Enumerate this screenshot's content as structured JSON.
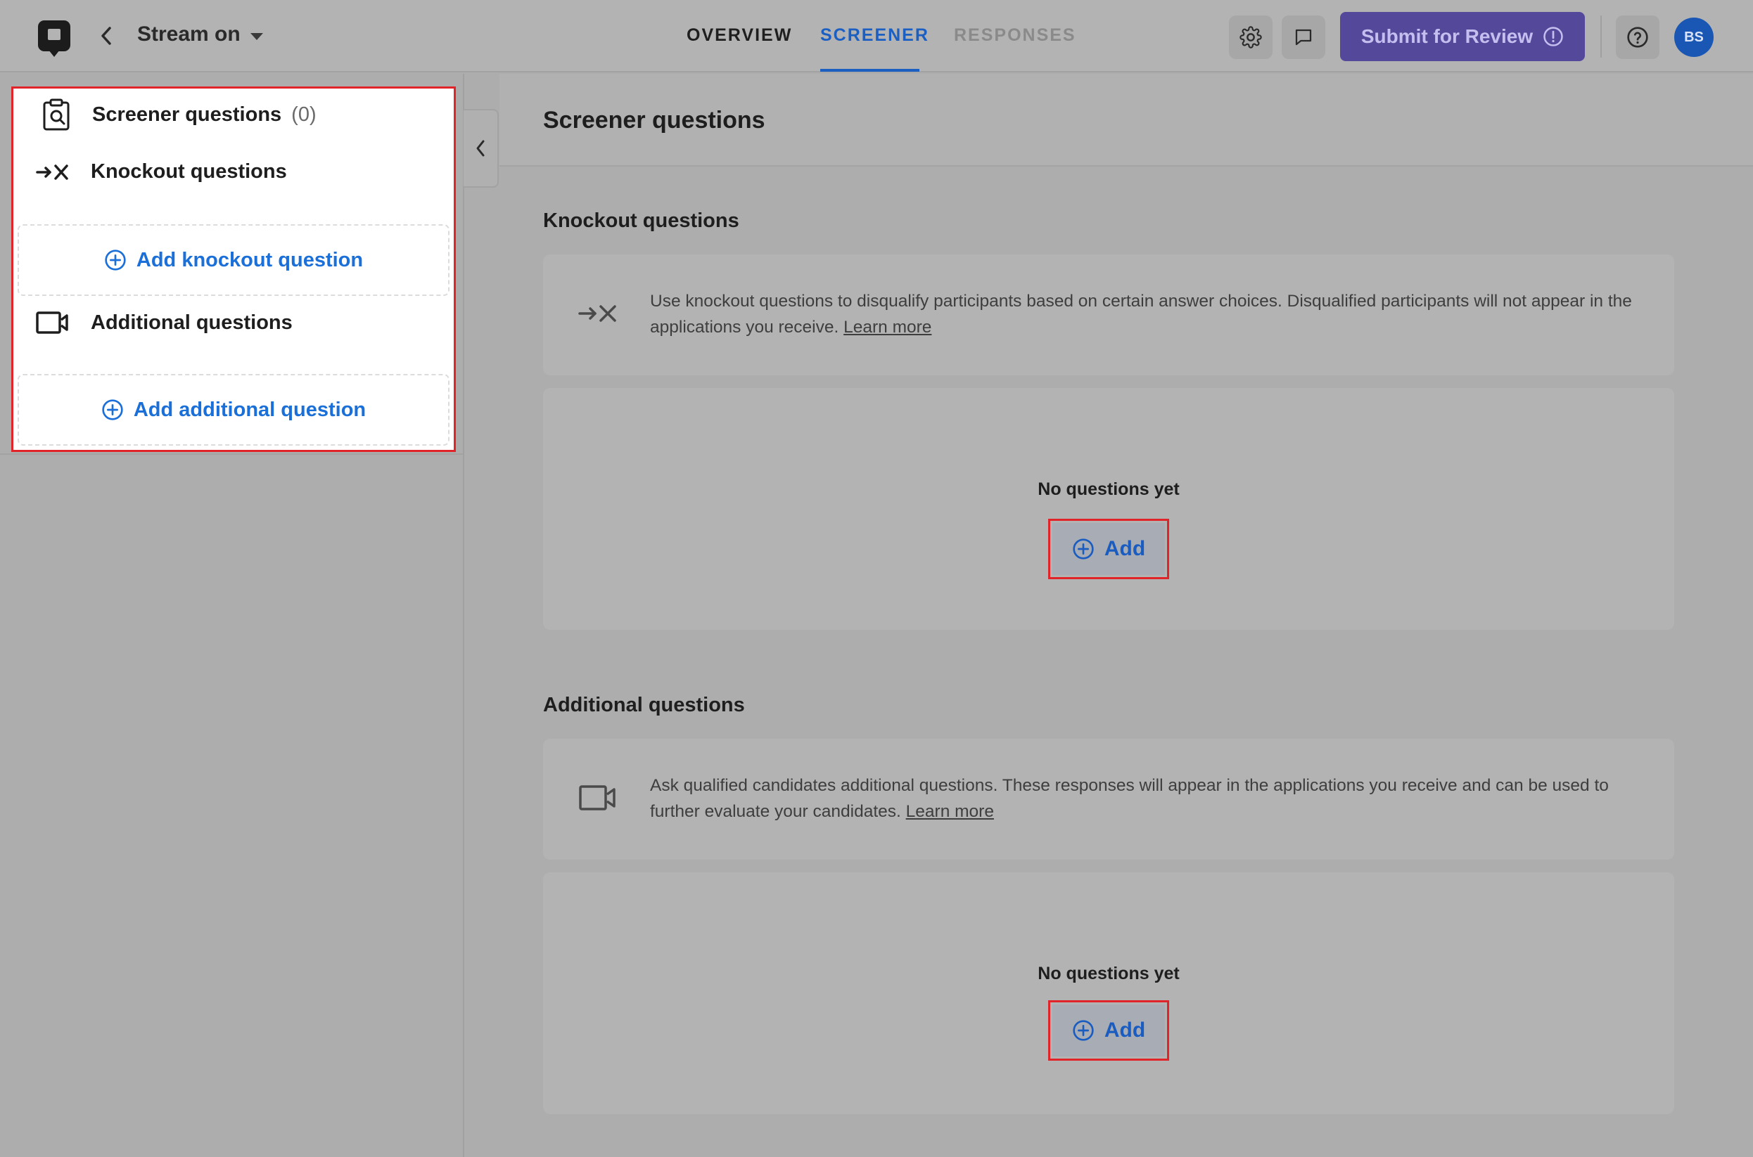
{
  "header": {
    "project_title": "Stream on",
    "tabs": [
      "OVERVIEW",
      "SCREENER",
      "RESPONSES"
    ],
    "submit_label": "Submit for Review",
    "avatar_initials": "BS"
  },
  "sidebar": {
    "screener_heading": "Screener questions",
    "screener_count": "(0)",
    "knockout_heading": "Knockout questions",
    "add_knockout_label": "Add knockout question",
    "additional_heading": "Additional questions",
    "add_additional_label": "Add additional question"
  },
  "main": {
    "title": "Screener questions",
    "knockout": {
      "title": "Knockout questions",
      "description": "Use knockout questions to disqualify participants based on certain answer choices. Disqualified participants will not appear in the applications you receive.",
      "learn_more": "Learn more",
      "empty_label": "No questions yet",
      "add_label": "Add"
    },
    "additional": {
      "title": "Additional questions",
      "description": "Ask qualified candidates additional questions. These responses will appear in the applications you receive and can be used to further evaluate your candidates.",
      "learn_more": "Learn more",
      "empty_label": "No questions yet",
      "add_label": "Add"
    }
  },
  "icons": {
    "logo": "app-logo-icon",
    "back": "chevron-left-icon",
    "dropdown": "caret-down-icon",
    "settings": "gear-icon",
    "comment": "comment-icon",
    "submit_info": "exclamation-circle-icon",
    "help": "question-circle-icon",
    "screener": "clipboard-search-icon",
    "knockout": "arrow-x-icon",
    "additional": "video-camera-icon",
    "add": "plus-circle-icon",
    "collapse": "chevron-left-icon"
  },
  "colors": {
    "accent_blue": "#1c5fc2",
    "link_blue": "#1a6fd8",
    "submit_purple": "#54489b",
    "highlight_red": "#e0242a",
    "avatar_blue": "#1a57b4"
  }
}
